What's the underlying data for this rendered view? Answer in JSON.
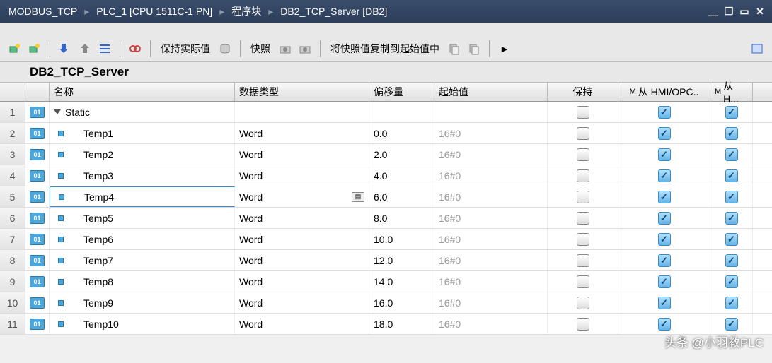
{
  "breadcrumb": [
    "MODBUS_TCP",
    "PLC_1 [CPU 1511C-1 PN]",
    "程序块",
    "DB2_TCP_Server [DB2]"
  ],
  "toolbar": {
    "keep_actual": "保持实际值",
    "snapshot": "快照",
    "copy_snap": "将快照值复制到起始值中"
  },
  "block_title": "DB2_TCP_Server",
  "columns": {
    "name": "名称",
    "type": "数据类型",
    "offset": "偏移量",
    "start": "起始值",
    "keep": "保持",
    "hmi": "从 HMI/OPC..",
    "h2": "从 H..."
  },
  "static_label": "Static",
  "rows": [
    {
      "n": "1",
      "name": "Static",
      "type": "",
      "off": "",
      "start": "",
      "keep": false,
      "hmi": true,
      "h2": true,
      "group": true
    },
    {
      "n": "2",
      "name": "Temp1",
      "type": "Word",
      "off": "0.0",
      "start": "16#0",
      "keep": false,
      "hmi": true,
      "h2": true
    },
    {
      "n": "3",
      "name": "Temp2",
      "type": "Word",
      "off": "2.0",
      "start": "16#0",
      "keep": false,
      "hmi": true,
      "h2": true
    },
    {
      "n": "4",
      "name": "Temp3",
      "type": "Word",
      "off": "4.0",
      "start": "16#0",
      "keep": false,
      "hmi": true,
      "h2": true
    },
    {
      "n": "5",
      "name": "Temp4",
      "type": "Word",
      "off": "6.0",
      "start": "16#0",
      "keep": false,
      "hmi": true,
      "h2": true,
      "sel": true
    },
    {
      "n": "6",
      "name": "Temp5",
      "type": "Word",
      "off": "8.0",
      "start": "16#0",
      "keep": false,
      "hmi": true,
      "h2": true
    },
    {
      "n": "7",
      "name": "Temp6",
      "type": "Word",
      "off": "10.0",
      "start": "16#0",
      "keep": false,
      "hmi": true,
      "h2": true
    },
    {
      "n": "8",
      "name": "Temp7",
      "type": "Word",
      "off": "12.0",
      "start": "16#0",
      "keep": false,
      "hmi": true,
      "h2": true
    },
    {
      "n": "9",
      "name": "Temp8",
      "type": "Word",
      "off": "14.0",
      "start": "16#0",
      "keep": false,
      "hmi": true,
      "h2": true
    },
    {
      "n": "10",
      "name": "Temp9",
      "type": "Word",
      "off": "16.0",
      "start": "16#0",
      "keep": false,
      "hmi": true,
      "h2": true
    },
    {
      "n": "11",
      "name": "Temp10",
      "type": "Word",
      "off": "18.0",
      "start": "16#0",
      "keep": false,
      "hmi": true,
      "h2": true
    }
  ],
  "watermark": "头条 @小羽教PLC"
}
